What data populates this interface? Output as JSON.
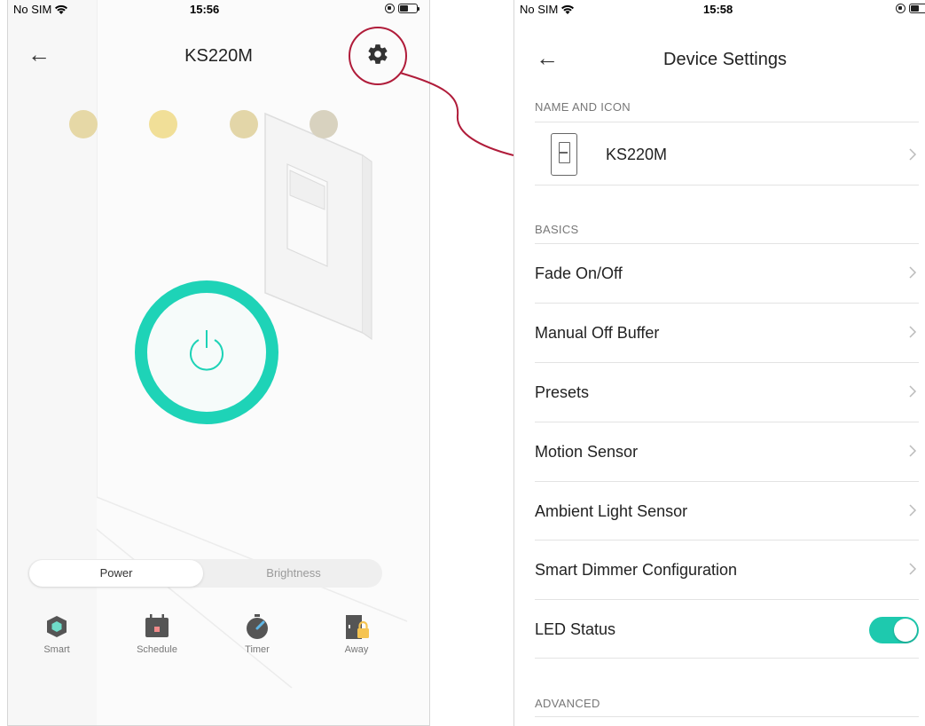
{
  "left": {
    "status": {
      "carrier": "No SIM",
      "time": "15:56"
    },
    "title": "KS220M",
    "preset_colors": [
      "#e6d8a6",
      "#f1df98",
      "#e3d6a8",
      "#d8d2bf"
    ],
    "segments": {
      "power": "Power",
      "brightness": "Brightness"
    },
    "tabs": {
      "smart": "Smart",
      "schedule": "Schedule",
      "timer": "Timer",
      "away": "Away"
    },
    "colors": {
      "accent": "#1ed3b7",
      "highlight": "#b01c3a"
    }
  },
  "right": {
    "status": {
      "carrier": "No SIM",
      "time": "15:58"
    },
    "title": "Device Settings",
    "sections": {
      "name_icon": "NAME AND ICON",
      "basics": "BASICS",
      "advanced": "ADVANCED"
    },
    "device_name": "KS220M",
    "items": {
      "fade": "Fade On/Off",
      "manual_off": "Manual Off Buffer",
      "presets": "Presets",
      "motion": "Motion Sensor",
      "ambient": "Ambient Light Sensor",
      "dimmer_config": "Smart Dimmer Configuration",
      "led_status": "LED Status"
    },
    "led_status_on": true
  }
}
